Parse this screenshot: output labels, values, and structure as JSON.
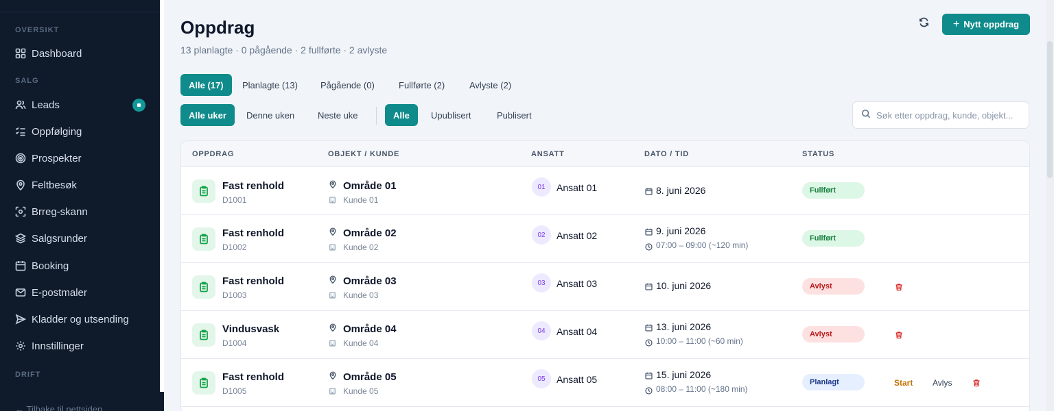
{
  "sidebar": {
    "sections": {
      "oversikt": "OVERSIKT",
      "salg": "SALG",
      "drift": "DRIFT"
    },
    "items": [
      {
        "label": "Dashboard",
        "icon": "grid-icon"
      },
      {
        "label": "Leads",
        "icon": "users-icon"
      },
      {
        "label": "Oppfølging",
        "icon": "checklist-icon"
      },
      {
        "label": "Prospekter",
        "icon": "target-icon"
      },
      {
        "label": "Feltbesøk",
        "icon": "map-pin-icon"
      },
      {
        "label": "Brreg-skann",
        "icon": "scan-icon"
      },
      {
        "label": "Salgsrunder",
        "icon": "layers-icon"
      },
      {
        "label": "Booking",
        "icon": "calendar-icon"
      },
      {
        "label": "E-postmaler",
        "icon": "mail-icon"
      },
      {
        "label": "Kladder og utsending",
        "icon": "send-icon"
      },
      {
        "label": "Innstillinger",
        "icon": "gear-icon"
      }
    ],
    "back_label": "Tilbake til nettsiden"
  },
  "header": {
    "title": "Oppdrag",
    "subtitle": "13 planlagte · 0 pågående · 2 fullførte · 2 avlyste",
    "new_button": "Nytt oppdrag"
  },
  "status_tabs": [
    "Alle (17)",
    "Planlagte (13)",
    "Pågående (0)",
    "Fullførte (2)",
    "Avlyste (2)"
  ],
  "week_filters": [
    "Alle uker",
    "Denne uken",
    "Neste uke"
  ],
  "publish_filters": [
    "Alle",
    "Upublisert",
    "Publisert"
  ],
  "search": {
    "placeholder": "Søk etter oppdrag, kunde, objekt..."
  },
  "table": {
    "headers": [
      "OPPDRAG",
      "OBJEKT / KUNDE",
      "ANSATT",
      "DATO / TID",
      "STATUS"
    ],
    "actions": {
      "start": "Start",
      "avlys": "Avlys"
    },
    "rows": [
      {
        "task": "Fast renhold",
        "code": "D1001",
        "object": "Område 01",
        "customer": "Kunde 01",
        "initials": "01",
        "employee": "Ansatt 01",
        "date": "8. juni 2026",
        "time": "",
        "status": "Fullført"
      },
      {
        "task": "Fast renhold",
        "code": "D1002",
        "object": "Område 02",
        "customer": "Kunde 02",
        "initials": "02",
        "employee": "Ansatt 02",
        "date": "9. juni 2026",
        "time": "07:00 – 09:00 (~120 min)",
        "status": "Fullført"
      },
      {
        "task": "Fast renhold",
        "code": "D1003",
        "object": "Område 03",
        "customer": "Kunde 03",
        "initials": "03",
        "employee": "Ansatt 03",
        "date": "10. juni 2026",
        "time": "",
        "status": "Avlyst"
      },
      {
        "task": "Vindusvask",
        "code": "D1004",
        "object": "Område 04",
        "customer": "Kunde 04",
        "initials": "04",
        "employee": "Ansatt 04",
        "date": "13. juni 2026",
        "time": "10:00 – 11:00 (~60 min)",
        "status": "Avlyst"
      },
      {
        "task": "Fast renhold",
        "code": "D1005",
        "object": "Område 05",
        "customer": "Kunde 05",
        "initials": "05",
        "employee": "Ansatt 05",
        "date": "15. juni 2026",
        "time": "08:00 – 11:00 (~180 min)",
        "status": "Planlagt"
      }
    ]
  },
  "colors": {
    "accent": "#0f8b8b",
    "sidebar_bg": "#0f1a2b",
    "page_bg": "#f1f4f8"
  }
}
